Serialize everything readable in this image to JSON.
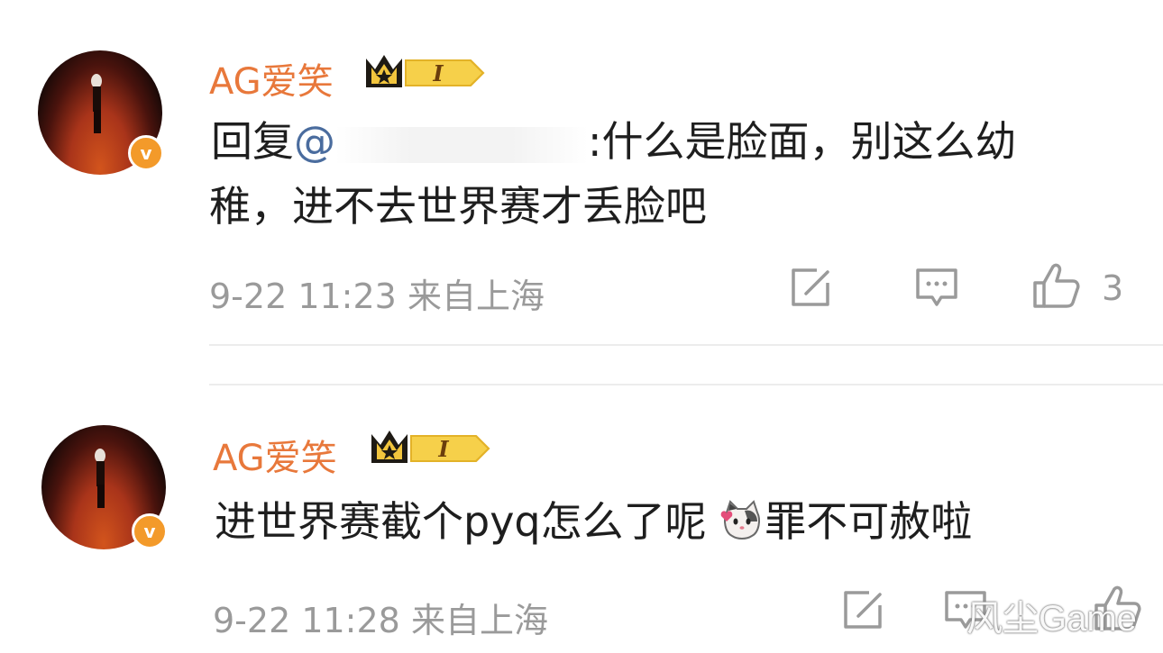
{
  "comments": [
    {
      "username": "AG爱笑",
      "level_badge": "I",
      "reply_prefix": "回复",
      "mention": "@",
      "line1_text": ":什么是脸面，别这么幼",
      "line2_text": "稚，进不去世界赛才丢脸吧",
      "timestamp": "9-22 11:23",
      "location": "来自上海",
      "like_count": "3",
      "verified_mark": "v"
    },
    {
      "username": "AG爱笑",
      "level_badge": "I",
      "text_before_emoji": "进世界赛截个pyq怎么了呢 ",
      "text_after_emoji": "罪不可赦啦",
      "timestamp": "9-22 11:28",
      "location": "来自上海",
      "verified_mark": "v"
    }
  ],
  "watermark": "风尘Game",
  "colors": {
    "username": "#e8783b",
    "body_text": "#1e1e1e",
    "meta_text": "#9a9a9a",
    "mention": "#4a6c9e",
    "verified_badge": "#f39a2a",
    "crown_gold": "#f2c53d"
  },
  "icons": [
    "share-icon",
    "comment-icon",
    "like-icon",
    "verified-icon",
    "crown-icon",
    "cat-emoji-icon"
  ]
}
